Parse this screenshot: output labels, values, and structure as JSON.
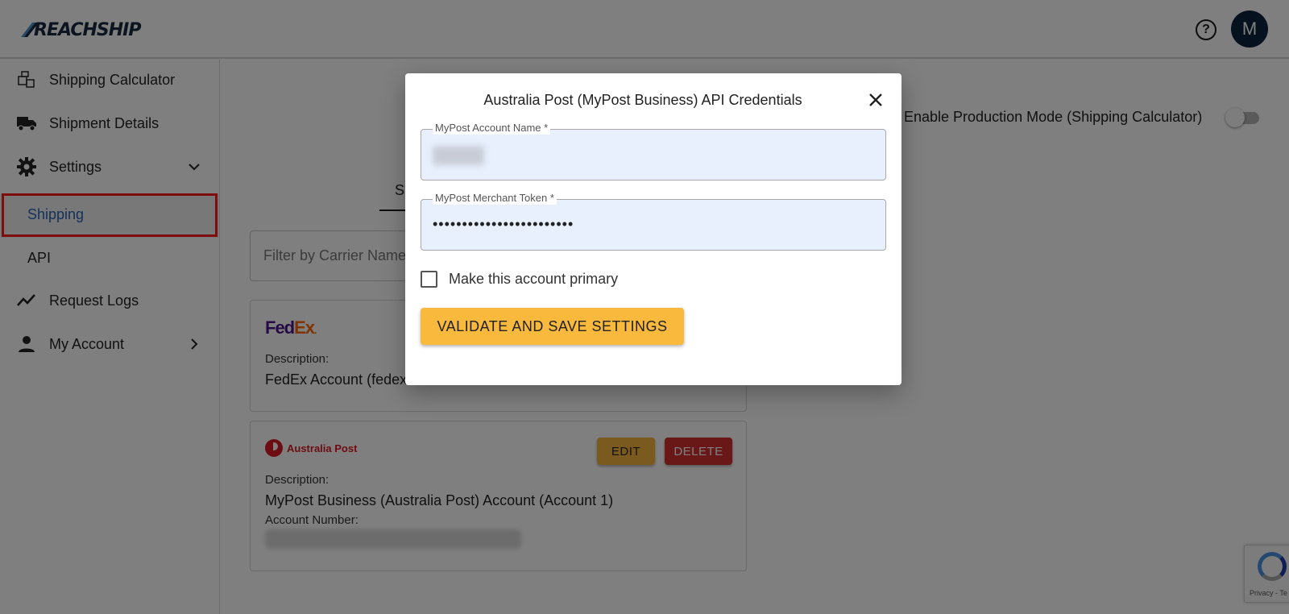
{
  "app": {
    "logo_text": "REACHSHIP",
    "help_icon": "help-circle-icon",
    "avatar_initial": "M"
  },
  "sidebar": {
    "items": [
      {
        "label": "Shipping Calculator",
        "icon": "packages-icon"
      },
      {
        "label": "Shipment Details",
        "icon": "truck-icon"
      },
      {
        "label": "Settings",
        "icon": "gear-icon",
        "expanded": true
      },
      {
        "label": "Request Logs",
        "icon": "trend-line-icon"
      },
      {
        "label": "My Account",
        "icon": "person-icon"
      }
    ],
    "settings_children": [
      {
        "label": "Shipping",
        "active": true
      },
      {
        "label": "API",
        "active": false
      }
    ],
    "highlight_color": "#ff1a1a",
    "active_color": "#2962b8"
  },
  "main": {
    "tab_partial": "S",
    "filter_placeholder": "Filter by Carrier Name",
    "production_label": "Enable Production Mode (Shipping Calculator)",
    "production_enabled": false,
    "cards": [
      {
        "carrier": "FedEx",
        "description_label": "Description:",
        "description": "FedEx Account (fedex"
      },
      {
        "carrier": "Australia Post",
        "description_label": "Description:",
        "description": "MyPost Business (Australia Post) Account (Account 1)",
        "account_number_label": "Account Number:",
        "edit_label": "EDIT",
        "delete_label": "DELETE"
      }
    ],
    "recaptcha_text": "Privacy - Te"
  },
  "modal": {
    "title": "Australia Post (MyPost Business) API Credentials",
    "fields": [
      {
        "label": "MyPost Account Name *",
        "value": ""
      },
      {
        "label": "MyPost Merchant Token *",
        "value": "••••••••••••••••••••••••"
      }
    ],
    "checkbox_label": "Make this account primary",
    "checkbox_checked": false,
    "submit_label": "VALIDATE AND SAVE SETTINGS",
    "accent_color": "#f9b93c"
  }
}
